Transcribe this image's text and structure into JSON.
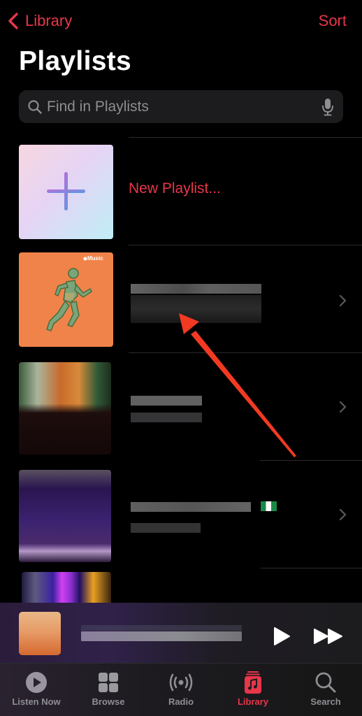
{
  "nav": {
    "back_label": "Library",
    "sort_label": "Sort"
  },
  "page": {
    "title": "Playlists"
  },
  "search": {
    "placeholder": "Find in Playlists",
    "value": ""
  },
  "playlists": {
    "new_playlist_label": "New Playlist...",
    "items": [
      {
        "artwork": "apple-music-running-playlist-art",
        "badge": "Music",
        "title_redacted": true
      },
      {
        "artwork": "redacted-artwork",
        "title_redacted": true
      },
      {
        "artwork": "redacted-artwork-purple",
        "title_redacted": true,
        "flag_emoji": "nigeria-flag"
      },
      {
        "artwork": "redacted-artwork-partial",
        "title_redacted": true
      }
    ]
  },
  "mini_player": {
    "title_redacted": true,
    "play_icon": "play-icon",
    "forward_icon": "fast-forward-icon"
  },
  "tabbar": {
    "tabs": [
      {
        "label": "Listen Now",
        "icon": "listen-now-icon",
        "active": false
      },
      {
        "label": "Browse",
        "icon": "browse-grid-icon",
        "active": false
      },
      {
        "label": "Radio",
        "icon": "radio-broadcast-icon",
        "active": false
      },
      {
        "label": "Library",
        "icon": "library-music-icon",
        "active": true
      },
      {
        "label": "Search",
        "icon": "search-icon",
        "active": false
      }
    ]
  },
  "annotation": {
    "type": "arrow",
    "color": "#f23a22",
    "points_to": "first-playlist-title"
  },
  "colors": {
    "accent": "#e8364a",
    "background": "#000000",
    "search_bg": "#1c1c1e"
  }
}
